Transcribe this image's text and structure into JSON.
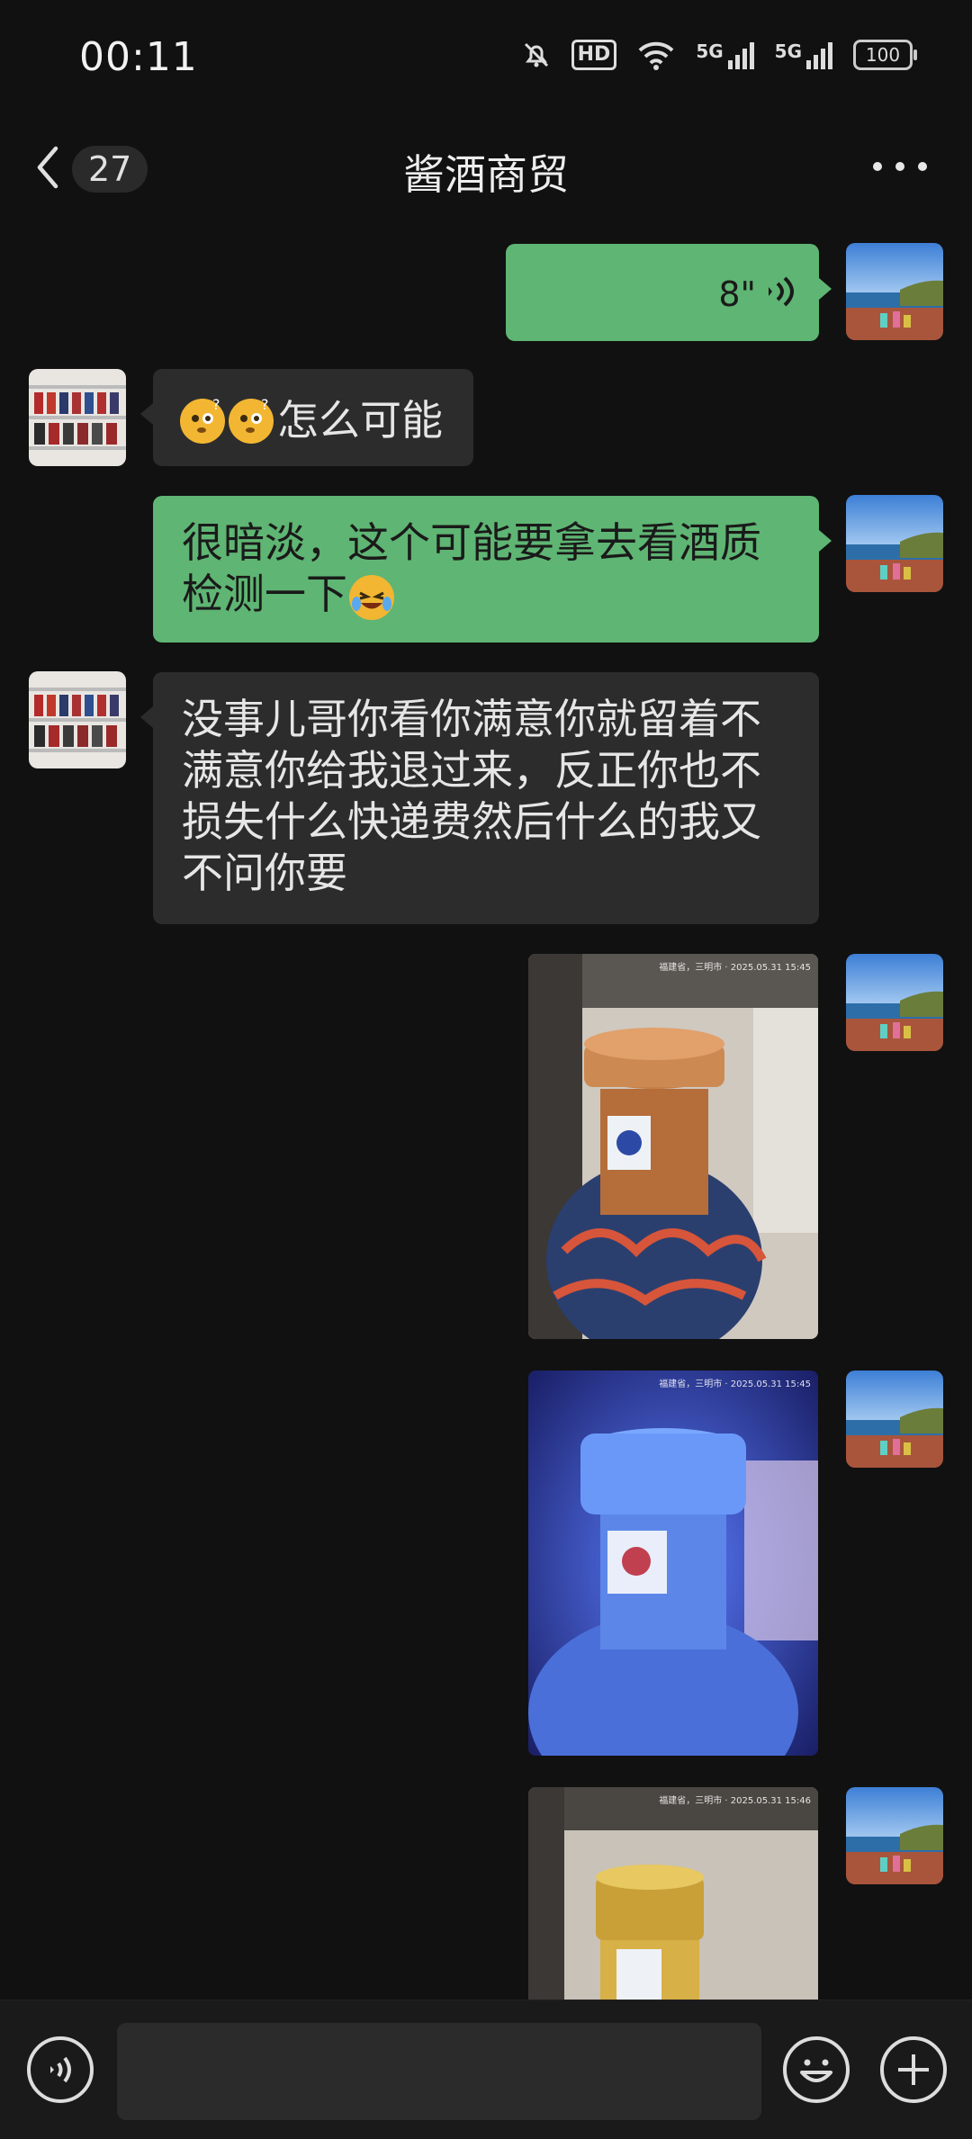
{
  "status_bar": {
    "time": "00:11",
    "hd_label": "HD",
    "sim1_label": "5G",
    "sim2_label": "5G",
    "battery": "100"
  },
  "header": {
    "back_count": "27",
    "title": "酱酒商贸"
  },
  "messages": [
    {
      "side": "sent",
      "type": "voice",
      "duration": "8\""
    },
    {
      "side": "received",
      "type": "text",
      "text": "怎么可能",
      "emoji_prefix": [
        "thinking-face-emoji",
        "thinking-face-emoji"
      ]
    },
    {
      "side": "sent",
      "type": "text",
      "text": "很暗淡，这个可能要拿去看酒质检测一下",
      "emoji_suffix": "laughing-tears-emoji"
    },
    {
      "side": "received",
      "type": "text",
      "text": "没事儿哥你看你满意你就留着不满意你给我退过来，反正你也不损失什么快递费然后什么的我又不问你要"
    },
    {
      "side": "sent",
      "type": "image",
      "stamp": "福建省，三明市 · 2025.05.31 15:45"
    },
    {
      "side": "sent",
      "type": "image",
      "stamp": "福建省，三明市 · 2025.05.31 15:45"
    },
    {
      "side": "sent",
      "type": "image",
      "stamp": "福建省，三明市 · 2025.05.31 15:46"
    }
  ],
  "colors": {
    "background": "#111111",
    "sent_bubble": "#5fb573",
    "received_bubble": "#2c2c2c"
  }
}
